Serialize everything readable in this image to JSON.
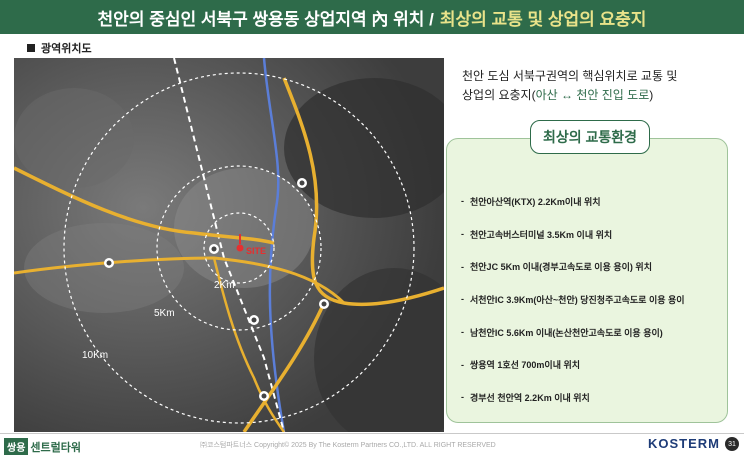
{
  "title": {
    "main": "천안의 중심인 서북구 쌍용동 상업지역 內 위치 /",
    "accent": "최상의 교통 및 상업의 요충지"
  },
  "section_label": "광역위치도",
  "map": {
    "site_label": "SITE",
    "rings": [
      "2Km",
      "5Km",
      "10Km"
    ],
    "colors": {
      "road_main": "#e8b030",
      "rail": "#5b7ed8",
      "ring": "#ffffff",
      "site": "#e53030"
    }
  },
  "intro": {
    "line1": "천안 도심 서북구권역의 핵심위치로 교통 및",
    "line2_prefix": "상업의 요충지(",
    "line2_highlight": "아산 ↔ 천안 진입 도로",
    "line2_suffix": ")"
  },
  "panel": {
    "title": "최상의 교통환경",
    "items": [
      "천안아산역(KTX) 2.2Km이내 위치",
      "천안고속버스터미널 3.5Km 이내 위치",
      "천안JC 5Km 이내(경부고속도로 이용 용이) 위치",
      "서천안IC 3.9Km(아산~천안) 당진청주고속도로 이용 용이",
      "남천안IC 5.6Km 이내(논산천안고속도로 이용 용이)",
      "쌍용역 1호선 700m이내 위치",
      "경부선 천안역 2.2Km 이내 위치"
    ]
  },
  "footer": {
    "brand_tag": "쌍용",
    "brand_name": "센트럴타워",
    "copyright": "㈜코스텀파트너스 Copyright© 2025 By The Kosterm Partners CO.,LTD. ALL RIGHT RESERVED",
    "logo": "KOSTERM",
    "page": "31"
  }
}
